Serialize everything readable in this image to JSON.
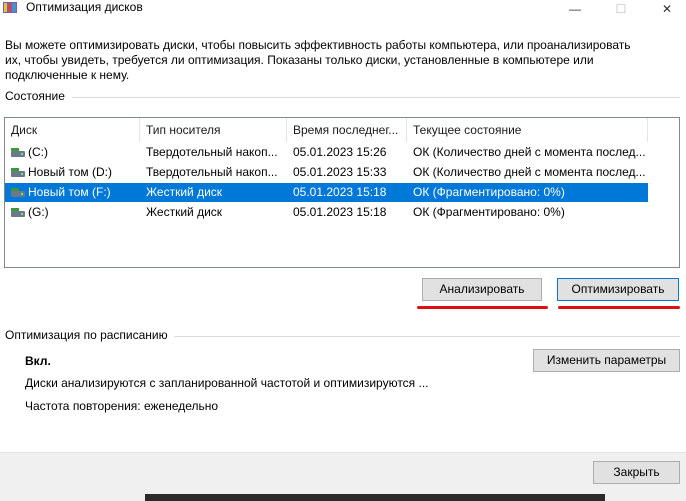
{
  "window": {
    "title": "Оптимизация дисков",
    "minimize_glyph": "—",
    "maximize_glyph": "☐",
    "close_glyph": "✕"
  },
  "intro_text": "Вы можете оптимизировать диски, чтобы повысить эффективность работы  компьютера, или проанализировать их, чтобы увидеть, требуется ли оптимизация. Показаны только диски, установленные в компьютере или подключенные к нему.",
  "status_section": {
    "label": "Состояние",
    "columns": [
      "Диск",
      "Тип носителя",
      "Время последнег...",
      "Текущее состояние"
    ],
    "rows": [
      {
        "drive": "(C:)",
        "media": "Твердотельный накоп...",
        "last_run": "05.01.2023 15:26",
        "status": "ОК (Количество дней с момента послед..."
      },
      {
        "drive": "Новый том (D:)",
        "media": "Твердотельный накоп...",
        "last_run": "05.01.2023 15:33",
        "status": "ОК (Количество дней с момента послед..."
      },
      {
        "drive": "Новый том (F:)",
        "media": "Жесткий диск",
        "last_run": "05.01.2023 15:18",
        "status": "ОК (Фрагментировано: 0%)"
      },
      {
        "drive": "(G:)",
        "media": "Жесткий диск",
        "last_run": "05.01.2023 15:18",
        "status": "ОК (Фрагментировано: 0%)"
      }
    ],
    "selected_row_index": 2,
    "analyze_button": "Анализировать",
    "optimize_button": "Оптимизировать"
  },
  "schedule_section": {
    "label": "Оптимизация по расписанию",
    "state": "Вкл.",
    "description": "Диски анализируются с запланированной частотой и оптимизируются ...",
    "frequency": "Частота повторения: еженедельно",
    "change_button": "Изменить параметры"
  },
  "footer": {
    "close_button": "Закрыть"
  },
  "colors": {
    "selection": "#0078d7",
    "annotation_underline": "#e01010",
    "button_face": "#e1e1e1"
  }
}
